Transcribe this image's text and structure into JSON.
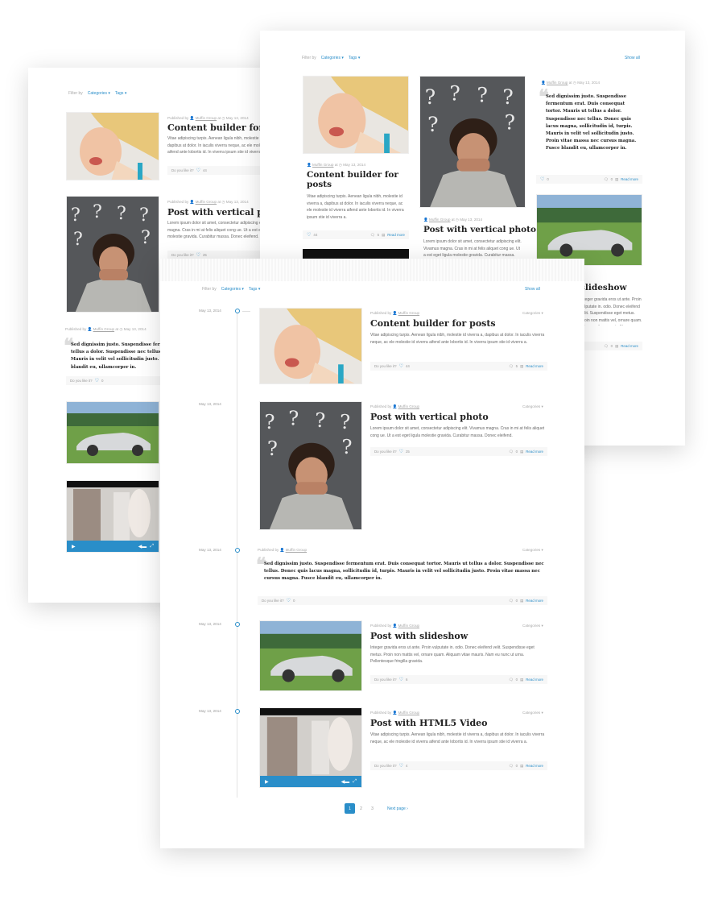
{
  "filter": {
    "label": "Filter by",
    "categories": "Categories ▾",
    "tags": "Tags ▾",
    "show_all": "Show all"
  },
  "meta": {
    "published_by": "Published by",
    "author": "Muffin Group",
    "at": "at",
    "date": "May 13, 2014"
  },
  "posts": {
    "content_builder": {
      "title": "Content builder for posts",
      "title_short": "Content builder for posts",
      "title_line1": "Content builder for",
      "title_line2": "posts",
      "excerpt": "Vitae adipiscing turpis. Aenean ligula nibh, molestie id viverra a, dapibus at dolor. In iaculis viverra neque, ac ele molestie id viverra aifend ante lobortis id. In viverra ipsum stie id viverra a.",
      "likes": "44",
      "comments": "5"
    },
    "vertical_photo": {
      "title": "Post with vertical photo",
      "excerpt": "Lorem ipsum dolor sit amet, consectetur adipiscing elit. Vivamus magna. Cras in mi at felis aliquet cong ue. Ut a est eget ligula molestie gravida. Curabitur massa. Donec eleifend.",
      "likes": "25",
      "comments": "0"
    },
    "quote": {
      "text": "Sed dignissim justo. Suspendisse fermentum erat. Duis consequat tortor. Mauris ut tellus a dolor. Suspendisse nec tellus. Donec quis lacus magna, sollicitudin id, turpis. Mauris in velit vel sollicitudin justo. Proin vitae massa nec cursus magna. Fusce blandit eu, ullamcorper in.",
      "likes": "0",
      "comments": "0"
    },
    "slideshow": {
      "title": "Post with slideshow",
      "title_partial": "slideshow",
      "excerpt": "Integer gravida eros ut ante. Proin vulputate in. odio. Donec eleifend velit. Suspendisse eget metus. Proin non mattis vel, ornare quam. Aliquam vitae mauris. Nam eu nunc ut urna. Pellentesque fringilla gravida.",
      "likes": "6",
      "comments": "0"
    },
    "video": {
      "title": "Post with HTML5 Video",
      "excerpt": "Vitae adipiscing turpis. Aenean ligula nibh, molestie id viverra a, dapibus at dolor. In iaculis viverra neque, ac ele molestie id viverra aifend ante lobortis id. In viverra ipsum stie id viverra a.",
      "likes": "4",
      "comments": "0"
    }
  },
  "footer": {
    "do_you_like": "Do you like it?",
    "read_more": "Read more"
  },
  "categories_label": "Categories ▾",
  "pagination": {
    "pages": [
      "1",
      "2",
      "3"
    ],
    "next": "Next page ›"
  },
  "icons": {
    "heart": "♡",
    "comment": "🗨",
    "doc": "▤",
    "user": "👤",
    "clock": "◷",
    "play": "▶",
    "volume": "◀",
    "fullscreen": "⤢"
  },
  "colors": {
    "accent": "#2a8ec9",
    "title": "#222222",
    "text": "#6a6a6a",
    "muted": "#a8a8a8"
  }
}
